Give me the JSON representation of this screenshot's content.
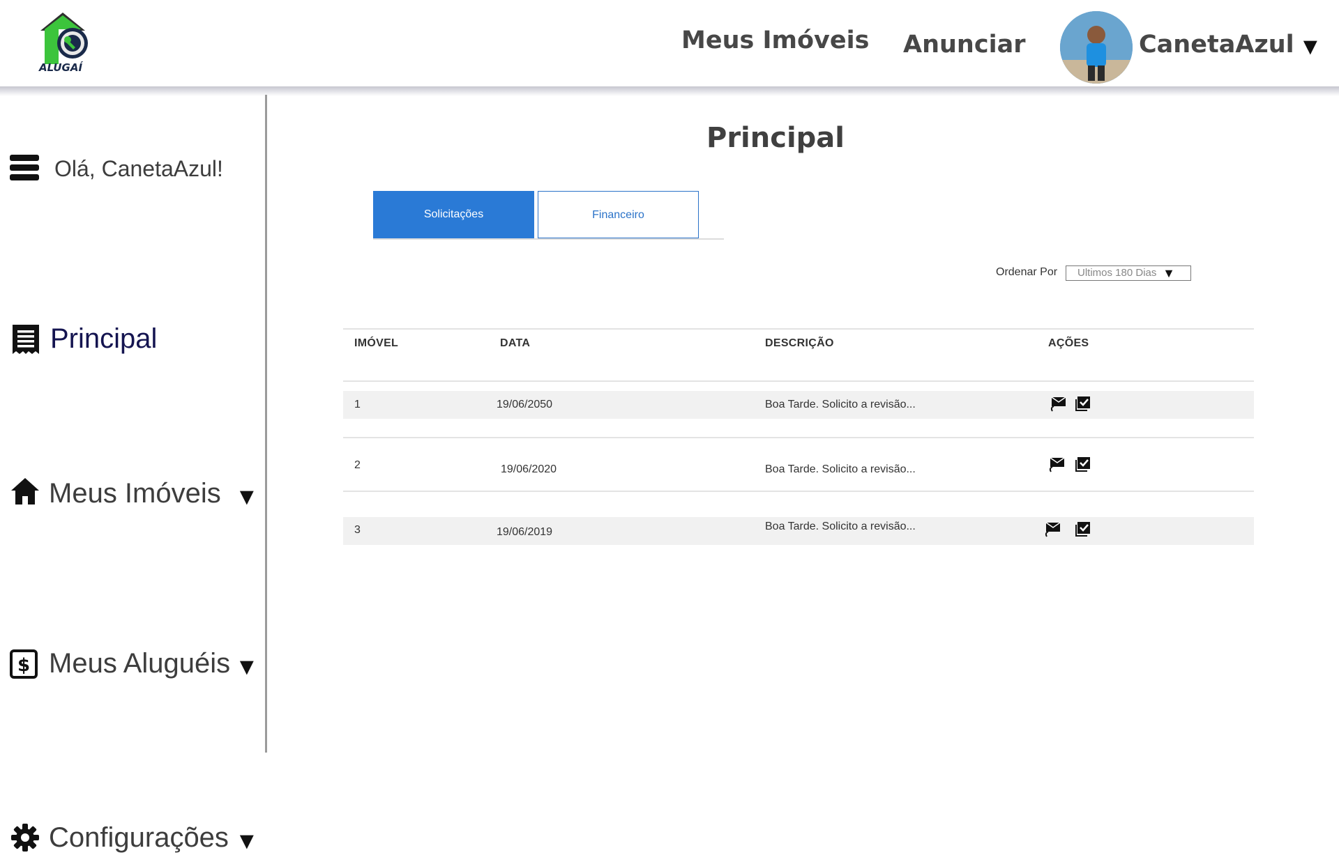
{
  "header": {
    "logo_text": "ALUGAÍ",
    "nav_meus_imoveis": "Meus Imóveis",
    "nav_anunciar": "Anunciar",
    "user_name": "CanetaAzul",
    "user_caret": "▼"
  },
  "sidebar": {
    "greeting": "Olá, CanetaAzul!",
    "items": [
      {
        "label": "Principal",
        "icon": "receipt-icon",
        "caret": ""
      },
      {
        "label": "Meus Imóveis",
        "icon": "home-icon",
        "caret": "▼"
      },
      {
        "label": "Meus Aluguéis",
        "icon": "dollar-icon",
        "caret": "▼"
      },
      {
        "label": "Configurações",
        "icon": "gear-icon",
        "caret": "▼"
      }
    ],
    "active_color": "#141450"
  },
  "main": {
    "title": "Principal",
    "tabs": [
      {
        "label": "Solicitações",
        "active": true
      },
      {
        "label": "Financeiro",
        "active": false
      }
    ],
    "sort_label": "Ordenar Por",
    "sort_value": "Ultimos 180 Dias",
    "sort_caret": "▼",
    "columns": [
      "IMÓVEL",
      "DATA",
      "DESCRIÇÃO",
      "AÇÕES"
    ],
    "rows": [
      {
        "imovel": "1",
        "data": "19/06/2050",
        "descricao": "Boa Tarde. Solicito a revisão..."
      },
      {
        "imovel": "2",
        "data": "19/06/2020",
        "descricao": "Boa Tarde. Solicito a revisão..."
      },
      {
        "imovel": "3",
        "data": "19/06/2019",
        "descricao": "Boa Tarde. Solicito a revisão..."
      }
    ],
    "row_actions": [
      "reply-mail-icon",
      "approve-check-icon"
    ]
  },
  "colors": {
    "accent": "#2a7ad6",
    "logo_green": "#3cc43c",
    "logo_dark": "#1a2a4a"
  }
}
